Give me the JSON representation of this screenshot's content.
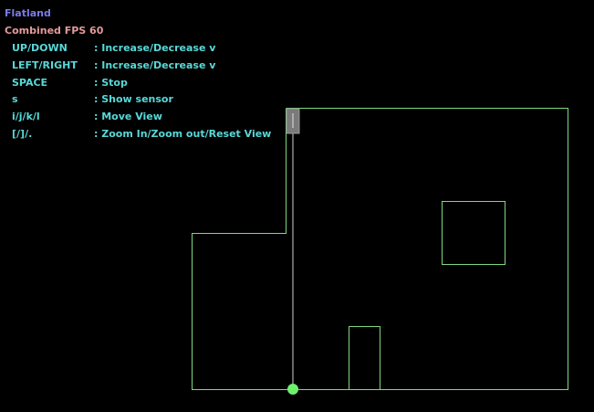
{
  "app": {
    "title": "Flatland",
    "fps_label": "Combined FPS 60"
  },
  "help": [
    {
      "key": "UP/DOWN",
      "desc": ": Increase/Decrease v"
    },
    {
      "key": "LEFT/RIGHT",
      "desc": ": Increase/Decrease v"
    },
    {
      "key": "SPACE",
      "desc": ": Stop"
    },
    {
      "key": "s",
      "desc": ": Show sensor"
    },
    {
      "key": "i/j/k/l",
      "desc": ": Move View"
    },
    {
      "key": "[/]/.",
      "desc": ": Zoom In/Zoom out/Reset View"
    }
  ],
  "colors": {
    "background": "#000000",
    "title": "#7b7bea",
    "fps": "#e39a9a",
    "help_text": "#58d8d8",
    "walls": "#7fd97f",
    "sensor_ray": "#d0d0d0",
    "sensor_box": "#7a7a7a",
    "robot": "#6ef06e"
  },
  "scene": {
    "robot": {
      "icon": "robot-dot-icon"
    },
    "sensor": {
      "icon": "sensor-icon"
    }
  }
}
